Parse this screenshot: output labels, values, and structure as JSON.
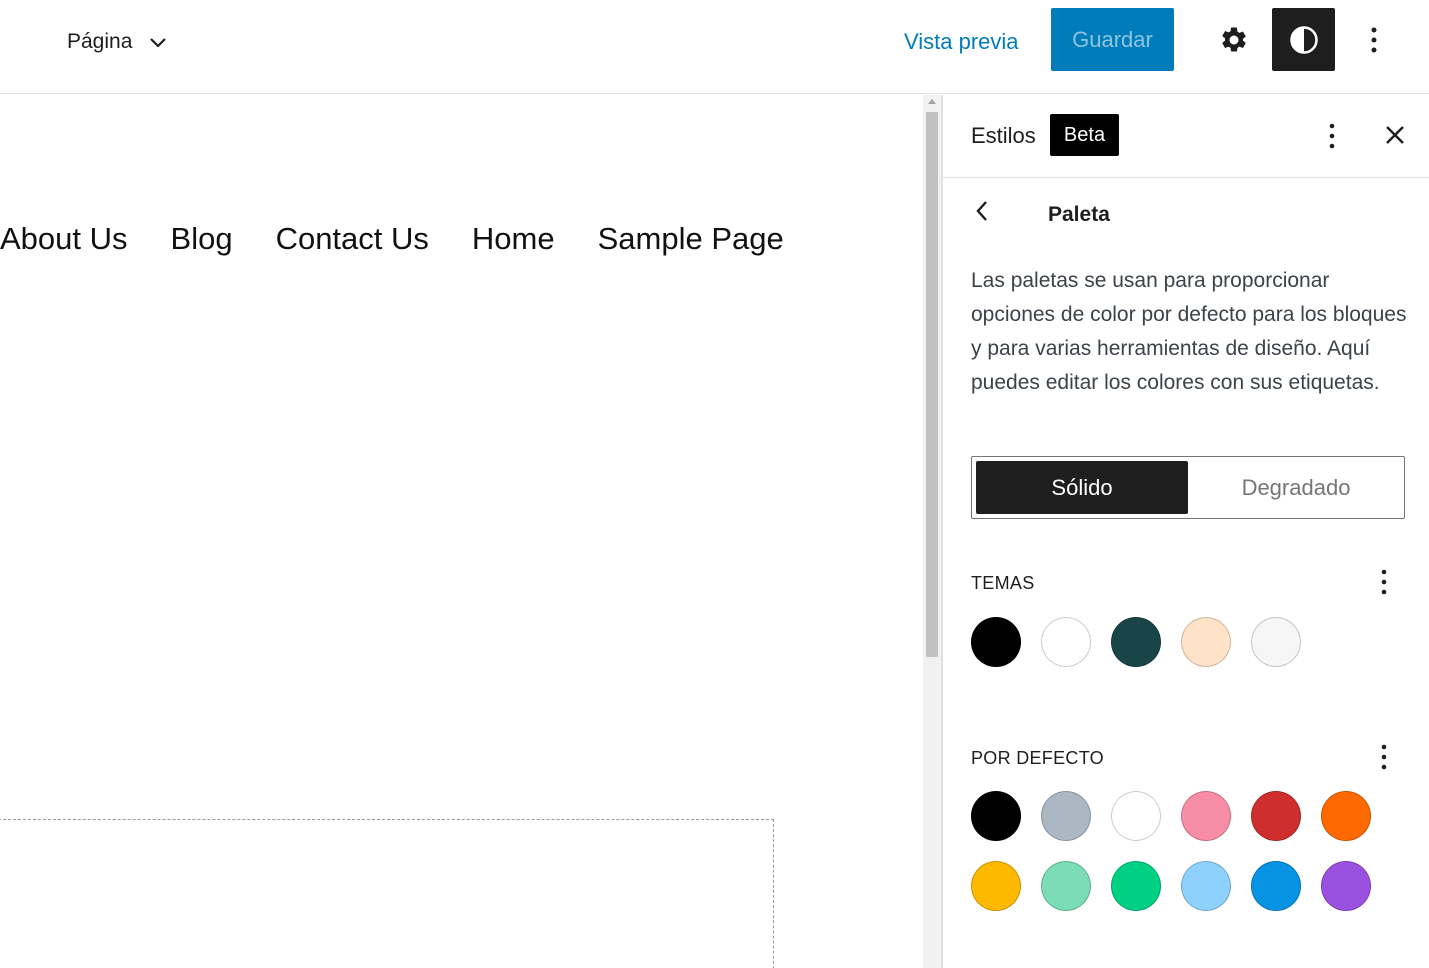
{
  "header": {
    "document_type": "Página",
    "preview_label": "Vista previa",
    "save_label": "Guardar",
    "icons": [
      "chevron-down-icon",
      "gear-icon",
      "styles-contrast-icon",
      "more-vertical-icon"
    ]
  },
  "canvas": {
    "nav_items": [
      "About Us",
      "Blog",
      "Contact Us",
      "Home",
      "Sample Page"
    ]
  },
  "sidebar": {
    "title": "Estilos",
    "badge": "Beta",
    "panel_title": "Paleta",
    "description": "Las paletas se usan para proporcionar opciones de color por defecto para los bloques y para varias herramientas de diseño. Aquí puedes editar los colores con sus etiquetas.",
    "tabs": {
      "solid": "Sólido",
      "gradient": "Degradado",
      "selected": "Sólido"
    },
    "theme_section": {
      "label": "TEMAS",
      "colors": [
        "#000000",
        "#ffffff",
        "#1a4548",
        "#ffe2c7",
        "#f6f6f6"
      ]
    },
    "default_section": {
      "label": "POR DEFECTO",
      "colors": [
        "#000000",
        "#abb8c3",
        "#ffffff",
        "#f78da7",
        "#cf2e2e",
        "#ff6900",
        "#fcb900",
        "#7bdcb5",
        "#00d084",
        "#8ed1fc",
        "#0693e3",
        "#9b51e0"
      ]
    }
  },
  "colors": {
    "accent": "#007cba",
    "dark": "#1e1e1e"
  }
}
